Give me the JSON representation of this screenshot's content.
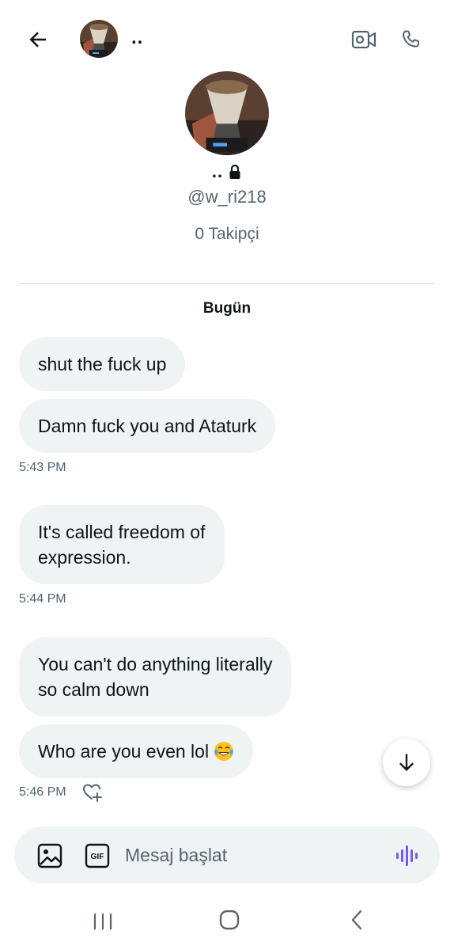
{
  "header": {
    "name": "..",
    "back_icon": "arrow-left-icon",
    "video_icon": "video-camera-icon",
    "call_icon": "phone-icon"
  },
  "profile": {
    "name": "..",
    "lock_icon": "lock-icon",
    "handle": "@w_ri218",
    "followers": "0 Takipçi"
  },
  "conversation": {
    "day_label": "Bugün",
    "messages": [
      {
        "text": "shut the fuck up"
      },
      {
        "text": "Damn fuck you and Ataturk"
      },
      {
        "text": "It's called freedom of\nexpression."
      },
      {
        "text": "You can't do anything literally\nso calm down"
      },
      {
        "text": "Who are you even lol"
      }
    ],
    "timestamps": [
      "5:43 PM",
      "5:44 PM",
      "5:46 PM"
    ],
    "emoji_icon": "face-with-tears-of-joy-icon",
    "react_icon": "heart-plus-icon",
    "scroll_icon": "arrow-down-icon"
  },
  "composer": {
    "placeholder": "Mesaj başlat",
    "gif_label": "GIF",
    "image_icon": "image-icon",
    "voice_icon": "voice-wave-icon",
    "voice_color": "#7856ff"
  },
  "colors": {
    "bubble": "#eff3f4",
    "secondary_text": "#536471",
    "divider": "#cfd9de"
  }
}
